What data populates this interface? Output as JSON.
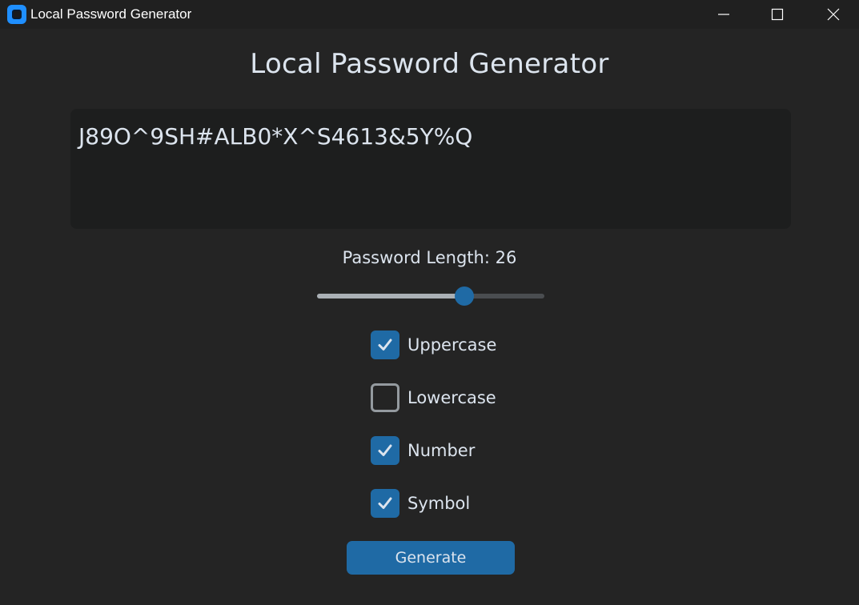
{
  "window": {
    "title": "Local Password Generator"
  },
  "main": {
    "heading": "Local Password Generator",
    "password": "J89O^9SH#ALB0*X^S4613&5Y%Q",
    "length_label": "Password Length: 26",
    "slider_fraction": 0.66,
    "options": [
      {
        "label": "Uppercase",
        "checked": true
      },
      {
        "label": "Lowercase",
        "checked": false
      },
      {
        "label": "Number",
        "checked": true
      },
      {
        "label": "Symbol",
        "checked": true
      }
    ],
    "generate_label": "Generate"
  },
  "colors": {
    "accent": "#1f6aa5",
    "background": "#242424",
    "titlebar": "#202020",
    "textbox": "#1d1e1e",
    "text": "#dce4ee"
  },
  "icons": {
    "app": "app-icon",
    "minimize": "minimize-icon",
    "maximize": "maximize-icon",
    "close": "close-icon",
    "check": "checkmark-icon"
  }
}
